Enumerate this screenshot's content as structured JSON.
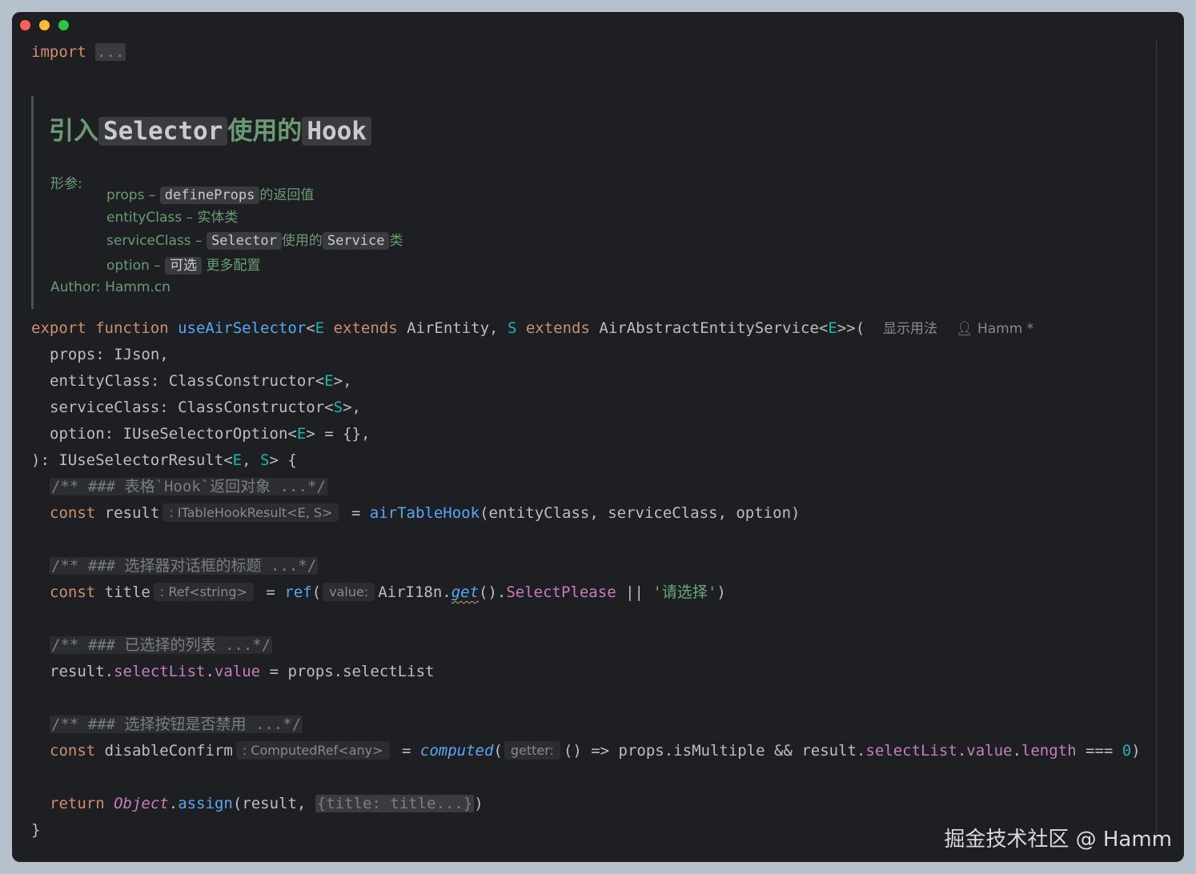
{
  "window": {
    "controls": [
      "close",
      "minimize",
      "maximize"
    ]
  },
  "editor": {
    "import_keyword": "import",
    "import_fold": "...",
    "doc": {
      "title_prefix": "引入",
      "title_code1": "Selector",
      "title_mid": "使用的",
      "title_code2": "Hook",
      "params_label": "形参:",
      "params": [
        {
          "name": "props –",
          "code": "defineProps",
          "desc": "的返回值"
        },
        {
          "name": "entityClass – 实体类"
        },
        {
          "name": "serviceClass –",
          "code": "Selector",
          "mid": "使用的",
          "code2": "Service",
          "desc": "类"
        },
        {
          "name": "option –",
          "code": "可选",
          "desc": "更多配置"
        }
      ],
      "author_label": "Author:",
      "author_value": "Hamm.cn"
    },
    "signature": {
      "kw_export": "export",
      "kw_function": "function",
      "fn_name": "useAirSelector",
      "lt": "<",
      "tp_e": "E",
      "kw_extends": "extends",
      "base_entity": "AirEntity,",
      "tp_s": "S",
      "base_service": "AirAbstractEntityService<",
      "close": ">>(",
      "lens_usage": "显示用法",
      "lens_author": "Hamm *"
    },
    "params_code": {
      "props": "props: IJson,",
      "entity_a": "entityClass: ClassConstructor<",
      "entity_b": ">,",
      "service_a": "serviceClass: ClassConstructor<",
      "service_b": ">,",
      "option_a": "option: IUseSelectorOption<",
      "option_b": "> = {},",
      "return_a": "): IUseSelectorResult<",
      "return_comma": ",",
      "return_b": "> {"
    },
    "comments": {
      "c1": "/** ### 表格`Hook`返回对象 ...*/",
      "c2": "/** ### 选择器对话框的标题 ...*/",
      "c3": "/** ### 已选择的列表 ...*/",
      "c4": "/** ### 选择按钮是否禁用 ...*/"
    },
    "body": {
      "const": "const",
      "result": "result",
      "hint_result": ": ITableHookResult<E, S>",
      "eq": "=",
      "tablehook": "airTableHook",
      "tablehook_args": "(entityClass, serviceClass, option)",
      "title": "title",
      "hint_title": ": Ref<string>",
      "ref": "ref",
      "paren_open": "(",
      "hint_value": "value:",
      "airi18n": "AirI18n.",
      "get": "get",
      "get_call": "().",
      "select_please": "SelectPlease",
      "or": "||",
      "str_select": "'请选择'",
      "paren_close": ")",
      "result_dot": "result.",
      "selectlist": "selectList",
      "dot": ".",
      "value": "value",
      "assign_rhs": "= props.selectList",
      "disable": "disableConfirm",
      "hint_disable": ": ComputedRef<any>",
      "computed": "computed",
      "hint_getter": "getter:",
      "arrow": "() => props.isMultiple && result.",
      "length": "length",
      "triple_eq": "===",
      "zero": "0",
      "return": "return",
      "object": "Object",
      "assign": "assign",
      "return_args": "(result, ",
      "fold_title": "{title: title...}",
      "return_close": ")",
      "brace_close": "}"
    }
  },
  "watermark": "掘金技术社区 @ Hamm"
}
